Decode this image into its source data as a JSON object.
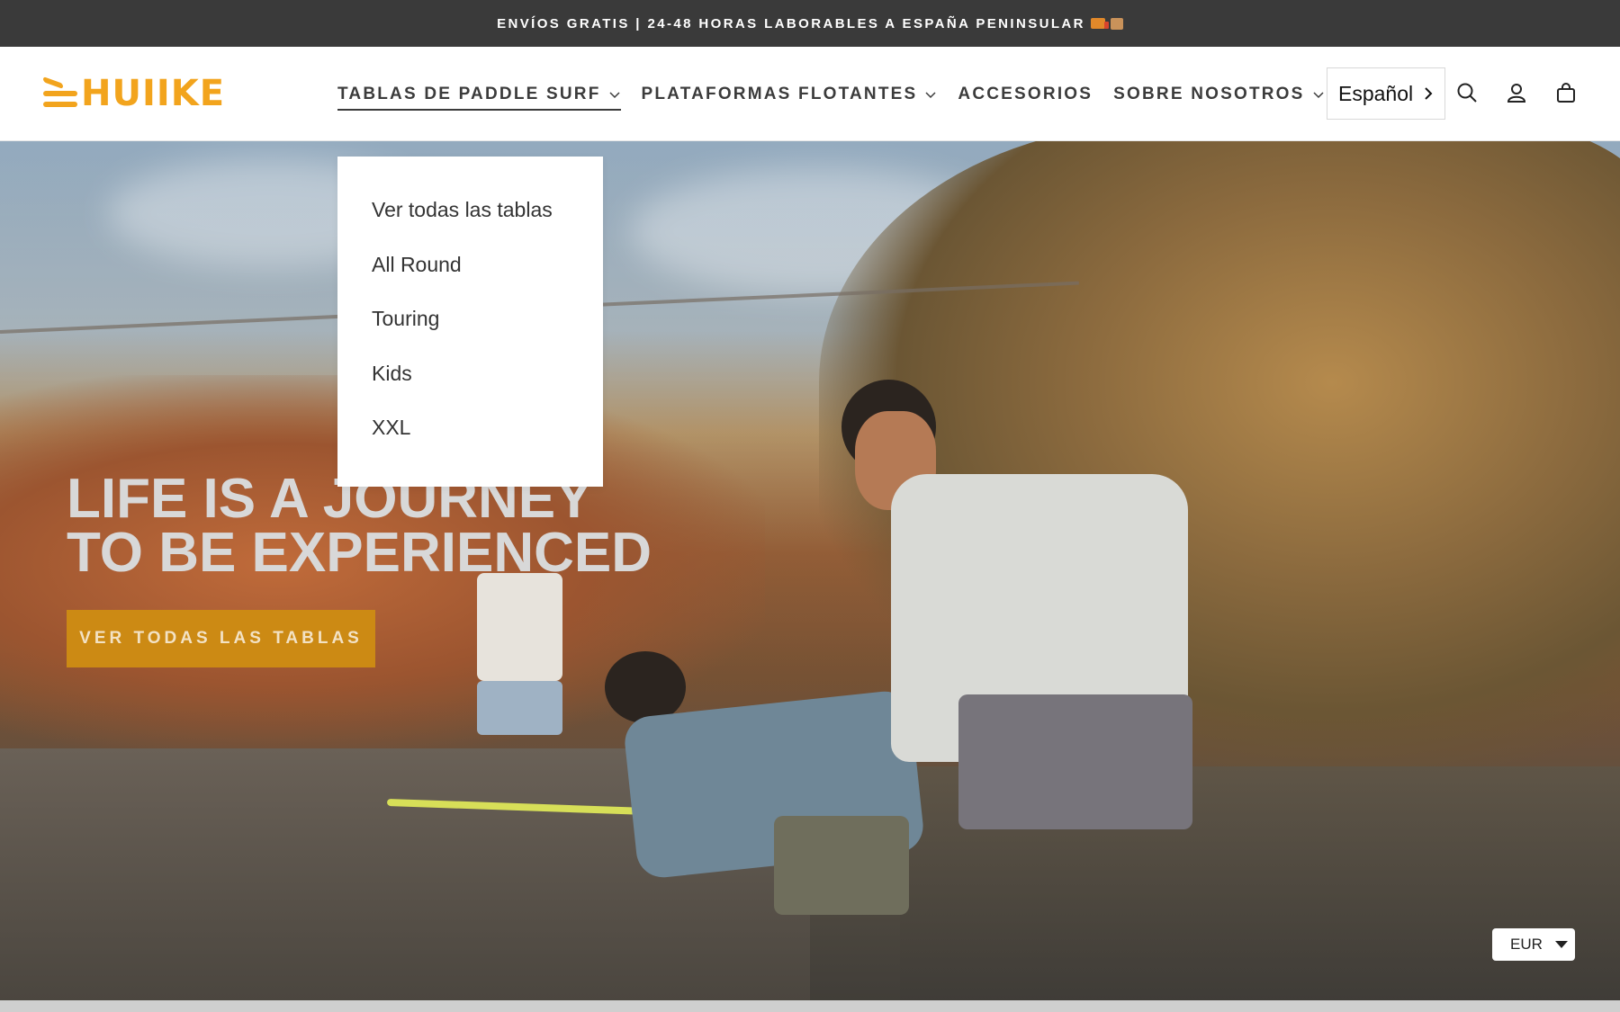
{
  "announcement": {
    "text": "ENVÍOS GRATIS | 24-48 HORAS LABORABLES A ESPAÑA PENINSULAR"
  },
  "brand": {
    "name": "HUIIKE",
    "color": "#f2a41d"
  },
  "nav": {
    "items": [
      {
        "label": "TABLAS DE PADDLE SURF",
        "has_dropdown": true,
        "active": true
      },
      {
        "label": "PLATAFORMAS FLOTANTES",
        "has_dropdown": true,
        "active": false
      },
      {
        "label": "ACCESORIOS",
        "has_dropdown": false,
        "active": false
      },
      {
        "label": "SOBRE NOSOTROS",
        "has_dropdown": true,
        "active": false
      }
    ]
  },
  "language": {
    "label": "Español"
  },
  "header_icons": [
    "search-icon",
    "account-icon",
    "cart-icon"
  ],
  "dropdown": {
    "items": [
      {
        "label": "Ver todas las tablas"
      },
      {
        "label": "All Round"
      },
      {
        "label": "Touring"
      },
      {
        "label": "Kids"
      },
      {
        "label": "XXL"
      }
    ]
  },
  "hero": {
    "title_line1": "LIFE IS A JOURNEY",
    "title_line2": "TO BE EXPERIENCED",
    "cta_label": "VER TODAS LAS TABLAS",
    "cta_color": "#cc8a14"
  },
  "currency": {
    "label": "EUR"
  }
}
